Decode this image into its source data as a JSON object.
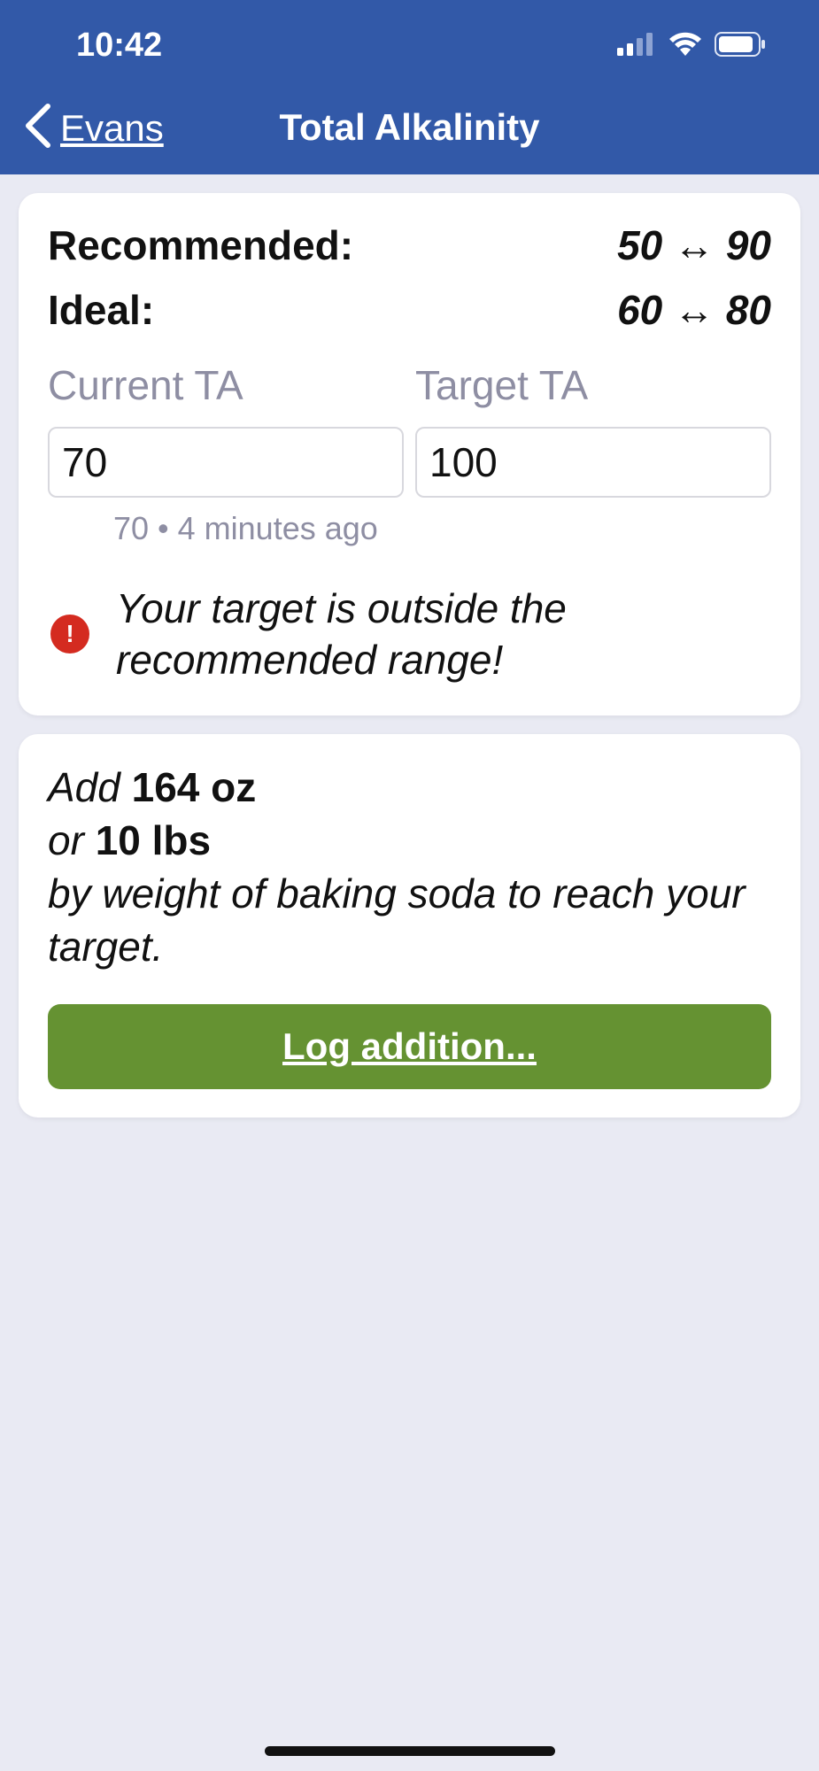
{
  "status_bar": {
    "time": "10:42",
    "icons": [
      "signal-icon",
      "wifi-icon",
      "battery-icon"
    ]
  },
  "nav": {
    "back_label": "Evans",
    "title": "Total Alkalinity"
  },
  "ranges": {
    "recommended_label": "Recommended:",
    "recommended_value": "50 ↔ 90",
    "ideal_label": "Ideal:",
    "ideal_value": "60 ↔ 80"
  },
  "inputs": {
    "current_label": "Current TA",
    "current_value": "70",
    "target_label": "Target TA",
    "target_value": "100",
    "history_note": "70 • 4 minutes ago"
  },
  "warning": {
    "icon": "exclamation-icon",
    "text": "Your target is outside the recommended range!"
  },
  "recommendation": {
    "add_word": "Add",
    "amount_oz": "164 oz",
    "or_word": "or",
    "amount_lbs": "10 lbs",
    "description": "by weight of baking soda to reach your target."
  },
  "actions": {
    "log_label": "Log addition..."
  },
  "colors": {
    "header": "#3259a8",
    "background": "#e9eaf3",
    "button": "#659232",
    "warning": "#d42b20",
    "muted_text": "#8e8ea3"
  }
}
